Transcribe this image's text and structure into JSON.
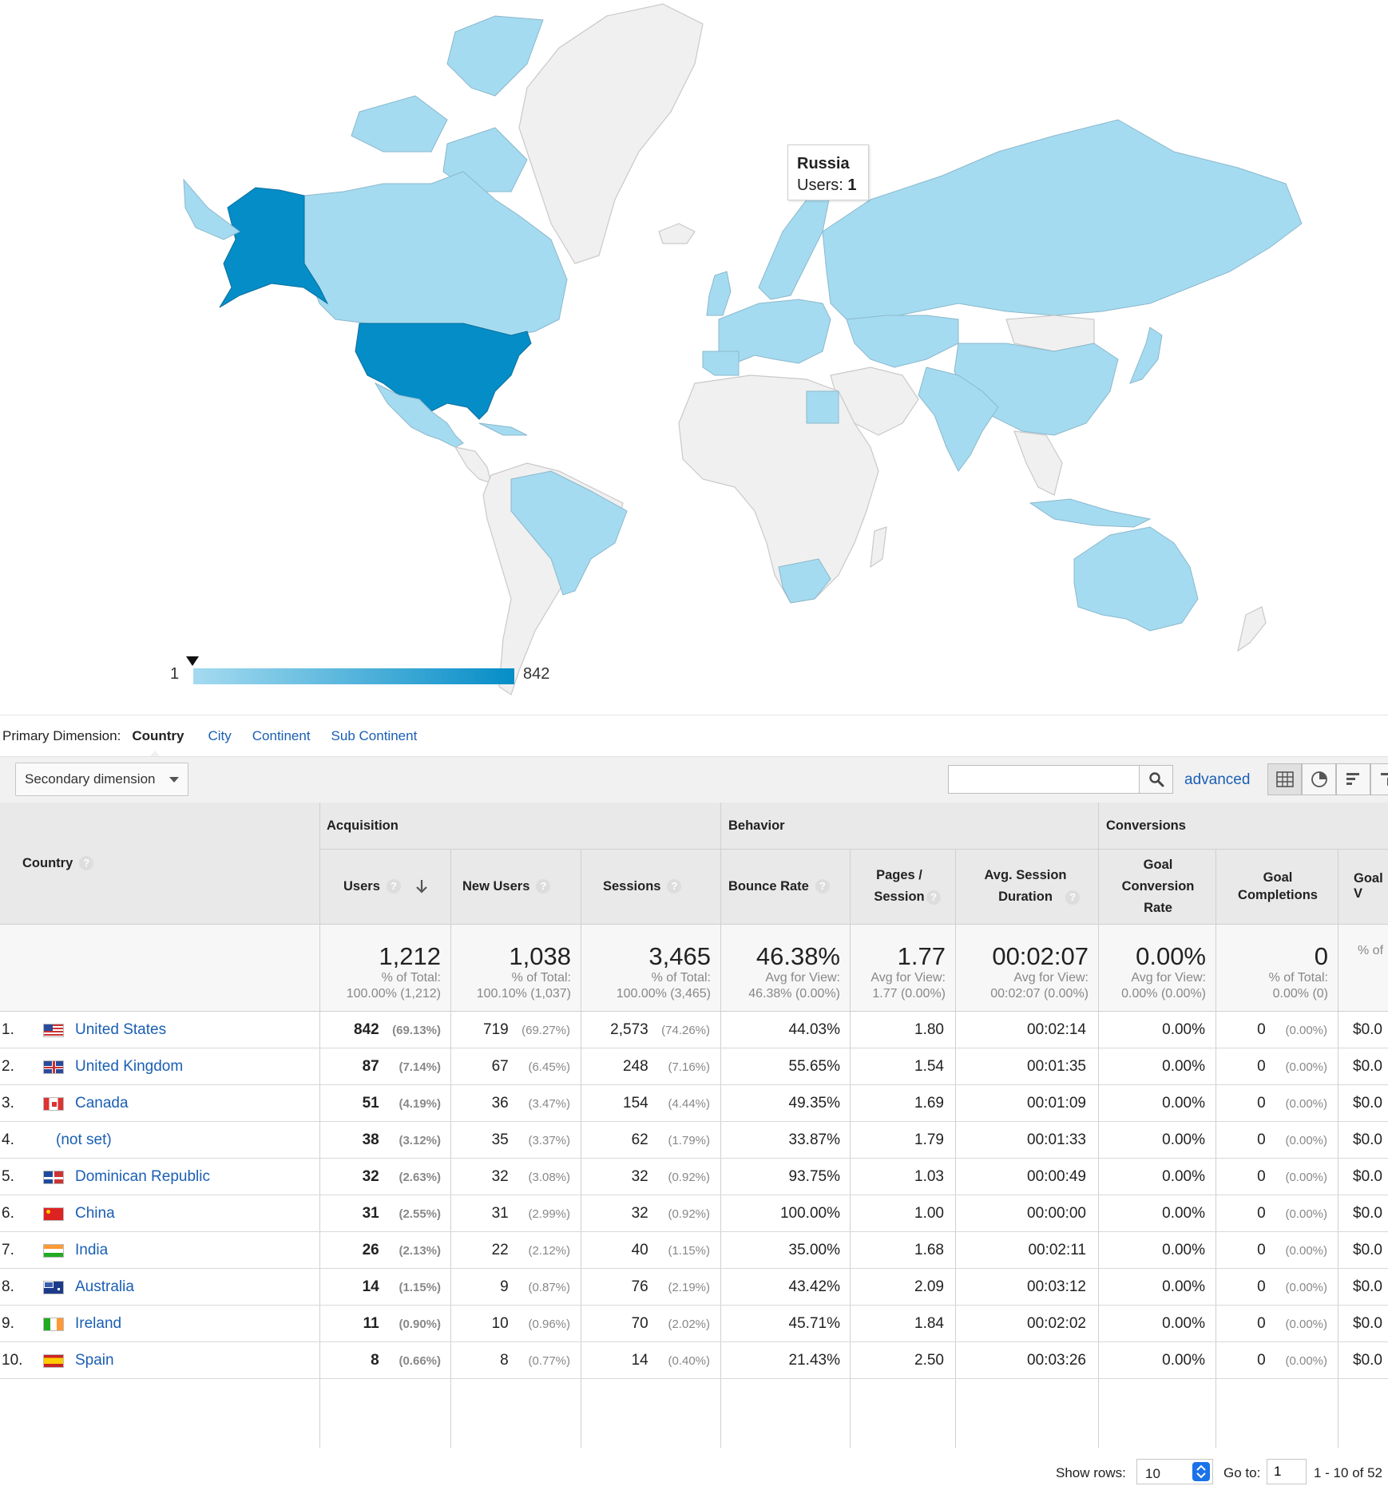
{
  "map": {
    "tooltip": {
      "country": "Russia",
      "metric_label": "Users:",
      "metric_value": "1"
    },
    "legend": {
      "min": "1",
      "max": "842"
    },
    "colors": {
      "no_data": "#f0f0f0",
      "low": "#a5dbf0",
      "high": "#058dc7"
    }
  },
  "primary_dimension": {
    "label": "Primary Dimension:",
    "active": "Country",
    "options": [
      "City",
      "Continent",
      "Sub Continent"
    ]
  },
  "toolbar": {
    "secondary_dimension": "Secondary dimension",
    "search_placeholder": "",
    "advanced": "advanced"
  },
  "table": {
    "country_header": "Country",
    "groups": [
      "Acquisition",
      "Behavior",
      "Conversions"
    ],
    "columns": [
      "Users",
      "New Users",
      "Sessions",
      "Bounce Rate",
      "Pages / Session",
      "Avg. Session Duration",
      "Goal Conversion Rate",
      "Goal Completions",
      "Goal V"
    ],
    "totals": [
      {
        "value": "1,212",
        "line1": "% of Total:",
        "line2": "100.00% (1,212)"
      },
      {
        "value": "1,038",
        "line1": "% of Total:",
        "line2": "100.10% (1,037)"
      },
      {
        "value": "3,465",
        "line1": "% of Total:",
        "line2": "100.00% (3,465)"
      },
      {
        "value": "46.38%",
        "line1": "Avg for View:",
        "line2": "46.38% (0.00%)"
      },
      {
        "value": "1.77",
        "line1": "Avg for View:",
        "line2": "1.77 (0.00%)"
      },
      {
        "value": "00:02:07",
        "line1": "Avg for View:",
        "line2": "00:02:07 (0.00%)"
      },
      {
        "value": "0.00%",
        "line1": "Avg for View:",
        "line2": "0.00% (0.00%)"
      },
      {
        "value": "0",
        "line1": "% of Total:",
        "line2": "0.00% (0)"
      },
      {
        "value": "",
        "line1": "% of",
        "line2": ""
      }
    ],
    "rows": [
      {
        "rank": "1.",
        "country": "United States",
        "flag": "us",
        "users": "842",
        "users_pct": "(69.13%)",
        "new_users": "719",
        "new_users_pct": "(69.27%)",
        "sessions": "2,573",
        "sessions_pct": "(74.26%)",
        "bounce": "44.03%",
        "pages": "1.80",
        "duration": "00:02:14",
        "conv": "0.00%",
        "completions": "0",
        "completions_pct": "(0.00%)",
        "value": "$0.0"
      },
      {
        "rank": "2.",
        "country": "United Kingdom",
        "flag": "gb",
        "users": "87",
        "users_pct": "(7.14%)",
        "new_users": "67",
        "new_users_pct": "(6.45%)",
        "sessions": "248",
        "sessions_pct": "(7.16%)",
        "bounce": "55.65%",
        "pages": "1.54",
        "duration": "00:01:35",
        "conv": "0.00%",
        "completions": "0",
        "completions_pct": "(0.00%)",
        "value": "$0.0"
      },
      {
        "rank": "3.",
        "country": "Canada",
        "flag": "ca",
        "users": "51",
        "users_pct": "(4.19%)",
        "new_users": "36",
        "new_users_pct": "(3.47%)",
        "sessions": "154",
        "sessions_pct": "(4.44%)",
        "bounce": "49.35%",
        "pages": "1.69",
        "duration": "00:01:09",
        "conv": "0.00%",
        "completions": "0",
        "completions_pct": "(0.00%)",
        "value": "$0.0"
      },
      {
        "rank": "4.",
        "country": "(not set)",
        "flag": "",
        "users": "38",
        "users_pct": "(3.12%)",
        "new_users": "35",
        "new_users_pct": "(3.37%)",
        "sessions": "62",
        "sessions_pct": "(1.79%)",
        "bounce": "33.87%",
        "pages": "1.79",
        "duration": "00:01:33",
        "conv": "0.00%",
        "completions": "0",
        "completions_pct": "(0.00%)",
        "value": "$0.0"
      },
      {
        "rank": "5.",
        "country": "Dominican Republic",
        "flag": "do",
        "users": "32",
        "users_pct": "(2.63%)",
        "new_users": "32",
        "new_users_pct": "(3.08%)",
        "sessions": "32",
        "sessions_pct": "(0.92%)",
        "bounce": "93.75%",
        "pages": "1.03",
        "duration": "00:00:49",
        "conv": "0.00%",
        "completions": "0",
        "completions_pct": "(0.00%)",
        "value": "$0.0"
      },
      {
        "rank": "6.",
        "country": "China",
        "flag": "cn",
        "users": "31",
        "users_pct": "(2.55%)",
        "new_users": "31",
        "new_users_pct": "(2.99%)",
        "sessions": "32",
        "sessions_pct": "(0.92%)",
        "bounce": "100.00%",
        "pages": "1.00",
        "duration": "00:00:00",
        "conv": "0.00%",
        "completions": "0",
        "completions_pct": "(0.00%)",
        "value": "$0.0"
      },
      {
        "rank": "7.",
        "country": "India",
        "flag": "in",
        "users": "26",
        "users_pct": "(2.13%)",
        "new_users": "22",
        "new_users_pct": "(2.12%)",
        "sessions": "40",
        "sessions_pct": "(1.15%)",
        "bounce": "35.00%",
        "pages": "1.68",
        "duration": "00:02:11",
        "conv": "0.00%",
        "completions": "0",
        "completions_pct": "(0.00%)",
        "value": "$0.0"
      },
      {
        "rank": "8.",
        "country": "Australia",
        "flag": "au",
        "users": "14",
        "users_pct": "(1.15%)",
        "new_users": "9",
        "new_users_pct": "(0.87%)",
        "sessions": "76",
        "sessions_pct": "(2.19%)",
        "bounce": "43.42%",
        "pages": "2.09",
        "duration": "00:03:12",
        "conv": "0.00%",
        "completions": "0",
        "completions_pct": "(0.00%)",
        "value": "$0.0"
      },
      {
        "rank": "9.",
        "country": "Ireland",
        "flag": "ie",
        "users": "11",
        "users_pct": "(0.90%)",
        "new_users": "10",
        "new_users_pct": "(0.96%)",
        "sessions": "70",
        "sessions_pct": "(2.02%)",
        "bounce": "45.71%",
        "pages": "1.84",
        "duration": "00:02:02",
        "conv": "0.00%",
        "completions": "0",
        "completions_pct": "(0.00%)",
        "value": "$0.0"
      },
      {
        "rank": "10.",
        "country": "Spain",
        "flag": "es",
        "users": "8",
        "users_pct": "(0.66%)",
        "new_users": "8",
        "new_users_pct": "(0.77%)",
        "sessions": "14",
        "sessions_pct": "(0.40%)",
        "bounce": "21.43%",
        "pages": "2.50",
        "duration": "00:03:26",
        "conv": "0.00%",
        "completions": "0",
        "completions_pct": "(0.00%)",
        "value": "$0.0"
      }
    ]
  },
  "footer": {
    "show_rows_label": "Show rows:",
    "show_rows_value": "10",
    "goto_label": "Go to:",
    "goto_value": "1",
    "range": "1 - 10 of 52"
  },
  "icons": {
    "search": "search-icon",
    "sort": "arrow-down-icon",
    "help": "help-icon"
  }
}
